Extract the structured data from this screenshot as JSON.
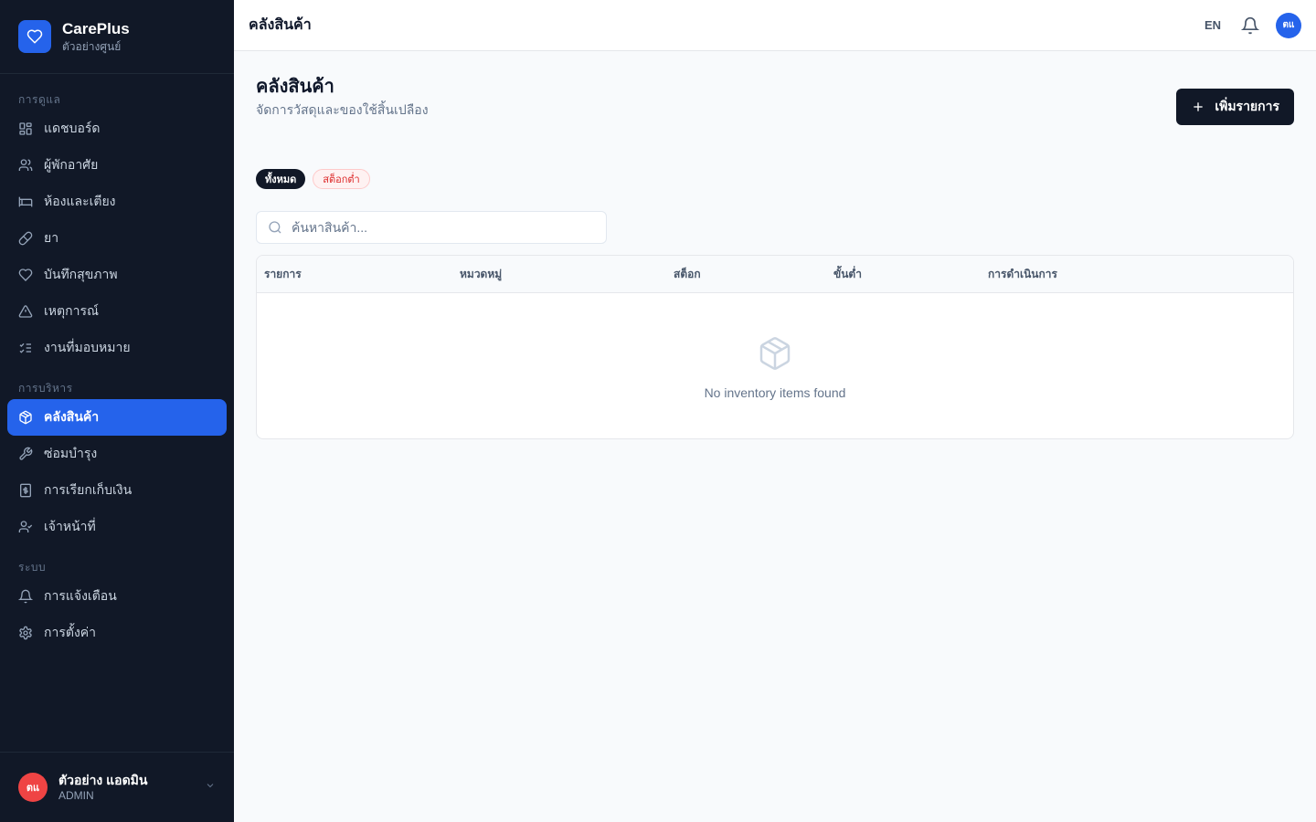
{
  "brand": {
    "name": "CarePlus",
    "subtitle": "ตัวอย่างศูนย์"
  },
  "sidebar": {
    "sections": [
      {
        "title": "การดูแล",
        "items": [
          {
            "label": "แดชบอร์ด",
            "icon": "dashboard-icon"
          },
          {
            "label": "ผู้พักอาศัย",
            "icon": "users-icon"
          },
          {
            "label": "ห้องและเตียง",
            "icon": "bed-icon"
          },
          {
            "label": "ยา",
            "icon": "pill-icon"
          },
          {
            "label": "บันทึกสุขภาพ",
            "icon": "heart-icon"
          },
          {
            "label": "เหตุการณ์",
            "icon": "alert-triangle-icon"
          },
          {
            "label": "งานที่มอบหมาย",
            "icon": "list-checks-icon"
          }
        ]
      },
      {
        "title": "การบริหาร",
        "items": [
          {
            "label": "คลังสินค้า",
            "icon": "package-icon",
            "active": true
          },
          {
            "label": "ซ่อมบำรุง",
            "icon": "wrench-icon"
          },
          {
            "label": "การเรียกเก็บเงิน",
            "icon": "receipt-icon"
          },
          {
            "label": "เจ้าหน้าที่",
            "icon": "user-check-icon"
          }
        ]
      },
      {
        "title": "ระบบ",
        "items": [
          {
            "label": "การแจ้งเตือน",
            "icon": "bell-icon"
          },
          {
            "label": "การตั้งค่า",
            "icon": "gear-icon"
          }
        ]
      }
    ]
  },
  "user": {
    "initials": "ตแ",
    "name": "ตัวอย่าง แอดมิน",
    "role": "ADMIN"
  },
  "header": {
    "title": "คลังสินค้า",
    "language": "EN",
    "avatar_initials": "ตแ"
  },
  "page": {
    "title": "คลังสินค้า",
    "subtitle": "จัดการวัสดุและของใช้สิ้นเปลือง",
    "add_button": "เพิ่มรายการ"
  },
  "filters": {
    "all": "ทั้งหมด",
    "low_stock": "สต็อกต่ำ"
  },
  "search": {
    "placeholder": "ค้นหาสินค้า...",
    "value": ""
  },
  "table": {
    "columns": [
      "รายการ",
      "หมวดหมู่",
      "สต็อก",
      "ขั้นต่ำ",
      "การดำเนินการ"
    ],
    "empty_text": "No inventory items found"
  },
  "colors": {
    "sidebar_bg": "#111827",
    "accent": "#2563eb",
    "danger": "#dc2626"
  }
}
